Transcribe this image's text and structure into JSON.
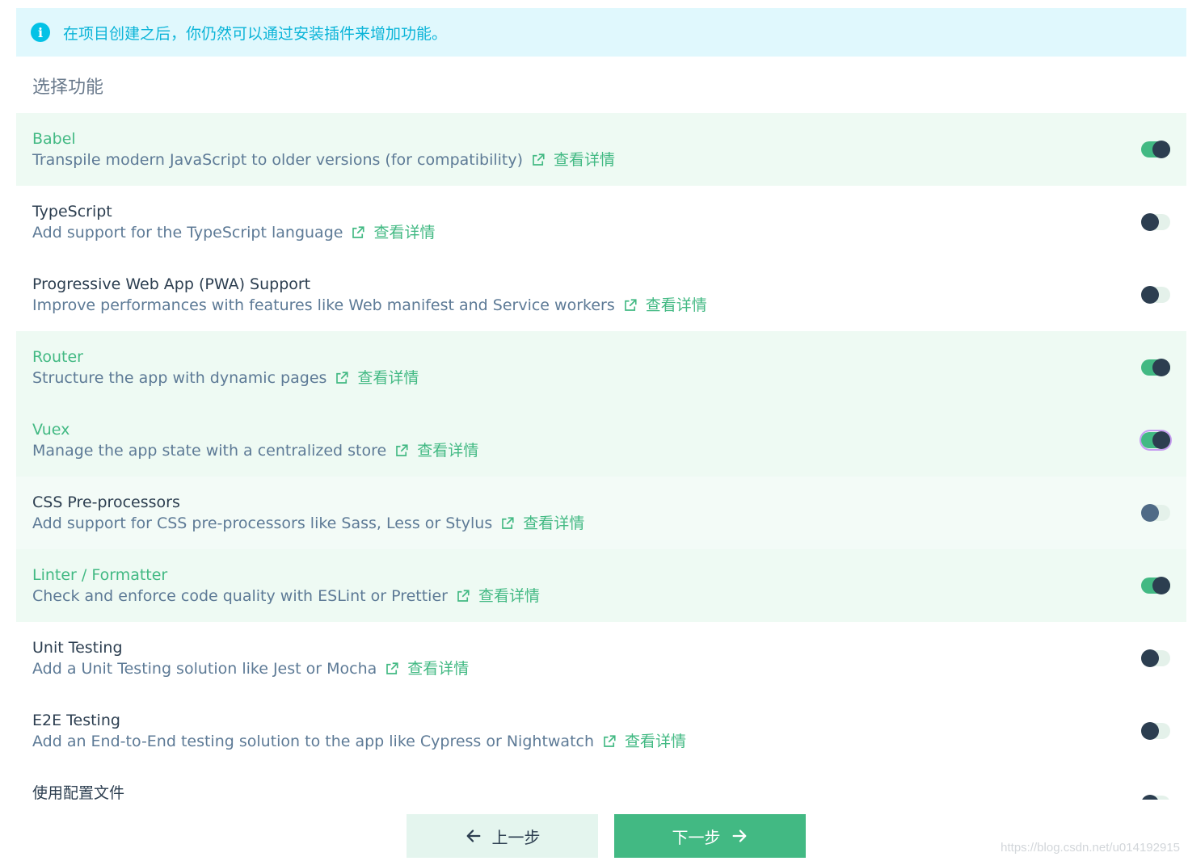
{
  "banner": {
    "icon": "info-icon",
    "text": "在项目创建之后，你仍然可以通过安装插件来增加功能。"
  },
  "section_title": "选择功能",
  "link_label": "查看详情",
  "colors": {
    "accent": "#42b983",
    "dark": "#2c3e50",
    "banner_bg": "#e0f8fd",
    "banner_text": "#0bb4d8",
    "selected_bg": "#eefaf3"
  },
  "features": [
    {
      "name": "Babel",
      "desc": "Transpile modern JavaScript to older versions (for compatibility)",
      "enabled": true
    },
    {
      "name": "TypeScript",
      "desc": "Add support for the TypeScript language",
      "enabled": false
    },
    {
      "name": "Progressive Web App (PWA) Support",
      "desc": "Improve performances with features like Web manifest and Service workers",
      "enabled": false
    },
    {
      "name": "Router",
      "desc": "Structure the app with dynamic pages",
      "enabled": true
    },
    {
      "name": "Vuex",
      "desc": "Manage the app state with a centralized store",
      "enabled": true
    },
    {
      "name": "CSS Pre-processors",
      "desc": "Add support for CSS pre-processors like Sass, Less or Stylus",
      "enabled": false
    },
    {
      "name": "Linter / Formatter",
      "desc": "Check and enforce code quality with ESLint or Prettier",
      "enabled": true
    },
    {
      "name": "Unit Testing",
      "desc": "Add a Unit Testing solution like Jest or Mocha",
      "enabled": false
    },
    {
      "name": "E2E Testing",
      "desc": "Add an End-to-End testing solution to the app like Cypress or Nightwatch",
      "enabled": false
    },
    {
      "name": "使用配置文件",
      "desc": "",
      "enabled": false
    }
  ],
  "footer": {
    "prev_label": "上一步",
    "next_label": "下一步"
  },
  "watermark": "https://blog.csdn.net/u014192915"
}
